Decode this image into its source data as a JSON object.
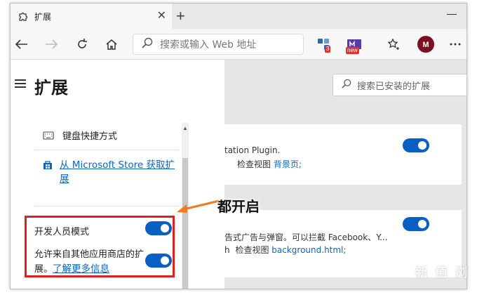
{
  "tab": {
    "title": "扩展",
    "close": "✕"
  },
  "newtab": "+",
  "toolbar": {
    "address_placeholder": "搜索或输入 Web 地址",
    "ext_badge_count": "3",
    "ext_new_badge": "new"
  },
  "sidebar": {
    "title": "扩展",
    "items": [
      {
        "label": "键盘快捷方式"
      },
      {
        "label": "从 Microsoft Store 获取扩展"
      }
    ],
    "dev_mode_label": "开发人员模式",
    "allow_other_label": "允许来自其他应用商店的扩展。",
    "learn_more": "了解更多信息"
  },
  "main": {
    "search_placeholder": "搜索已安装的扩展",
    "cards": [
      {
        "line1": "tation Plugin.",
        "detail_label": "检查视图",
        "detail_link": "背景页;"
      },
      {
        "line1": "告式广告与弹窗。可以拦截 Facebook、Y...",
        "detail_prefix": "h",
        "detail_label": "检查视图",
        "detail_link": "background.html;"
      }
    ]
  },
  "annotation": "都开启",
  "watermark": "新 值 浏"
}
